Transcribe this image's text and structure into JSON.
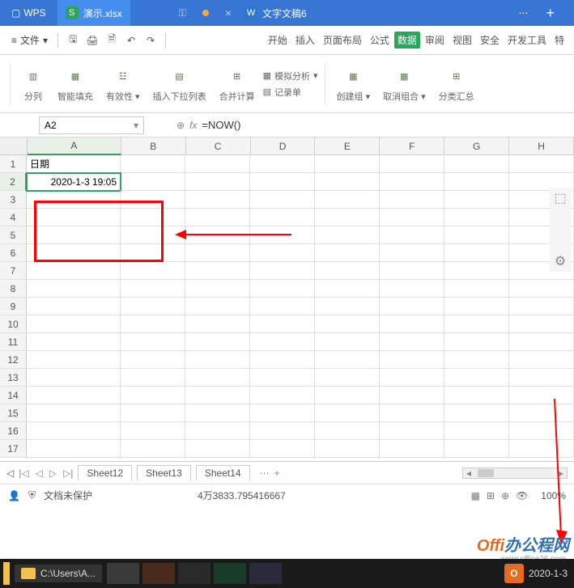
{
  "title_bar": {
    "app": "WPS",
    "tab1_icon": "S",
    "tab1_label": "演示.xlsx",
    "tab2_icon": "W",
    "tab2_label": "文字文稿6"
  },
  "menu": {
    "file": "文件",
    "tabs": [
      "开始",
      "插入",
      "页面布局",
      "公式",
      "数据",
      "审阅",
      "视图",
      "安全",
      "开发工具",
      "特"
    ]
  },
  "ribbon": {
    "split": "分列",
    "smartfill": "智能填充",
    "validity": "有效性",
    "dropdown": "插入下拉列表",
    "consolidate": "合并计算",
    "simulate": "模拟分析",
    "form": "记录单",
    "creategroup": "创建组",
    "ungroup": "取消组合",
    "subtotal": "分类汇总"
  },
  "formula": {
    "cell_ref": "A2",
    "fx": "fx",
    "value": "=NOW()"
  },
  "columns": [
    "A",
    "B",
    "C",
    "D",
    "E",
    "F",
    "G",
    "H"
  ],
  "rows": [
    "1",
    "2",
    "3",
    "4",
    "5",
    "6",
    "7",
    "8",
    "9",
    "10",
    "11",
    "12",
    "13",
    "14",
    "15",
    "16",
    "17"
  ],
  "cells": {
    "A1": "日期",
    "A2": "2020-1-3 19:05"
  },
  "sheets": {
    "s1": "Sheet12",
    "s2": "Sheet13",
    "s3": "Sheet14"
  },
  "status": {
    "protect": "文档未保护",
    "calc": "4万3833.795416667",
    "zoom": "100%"
  },
  "taskbar": {
    "item1": "C:\\Users\\A...",
    "time": "2020-1-3"
  },
  "watermark": {
    "t1": "Offi",
    "t2": "办公程网",
    "sub": "www.office26.com"
  }
}
